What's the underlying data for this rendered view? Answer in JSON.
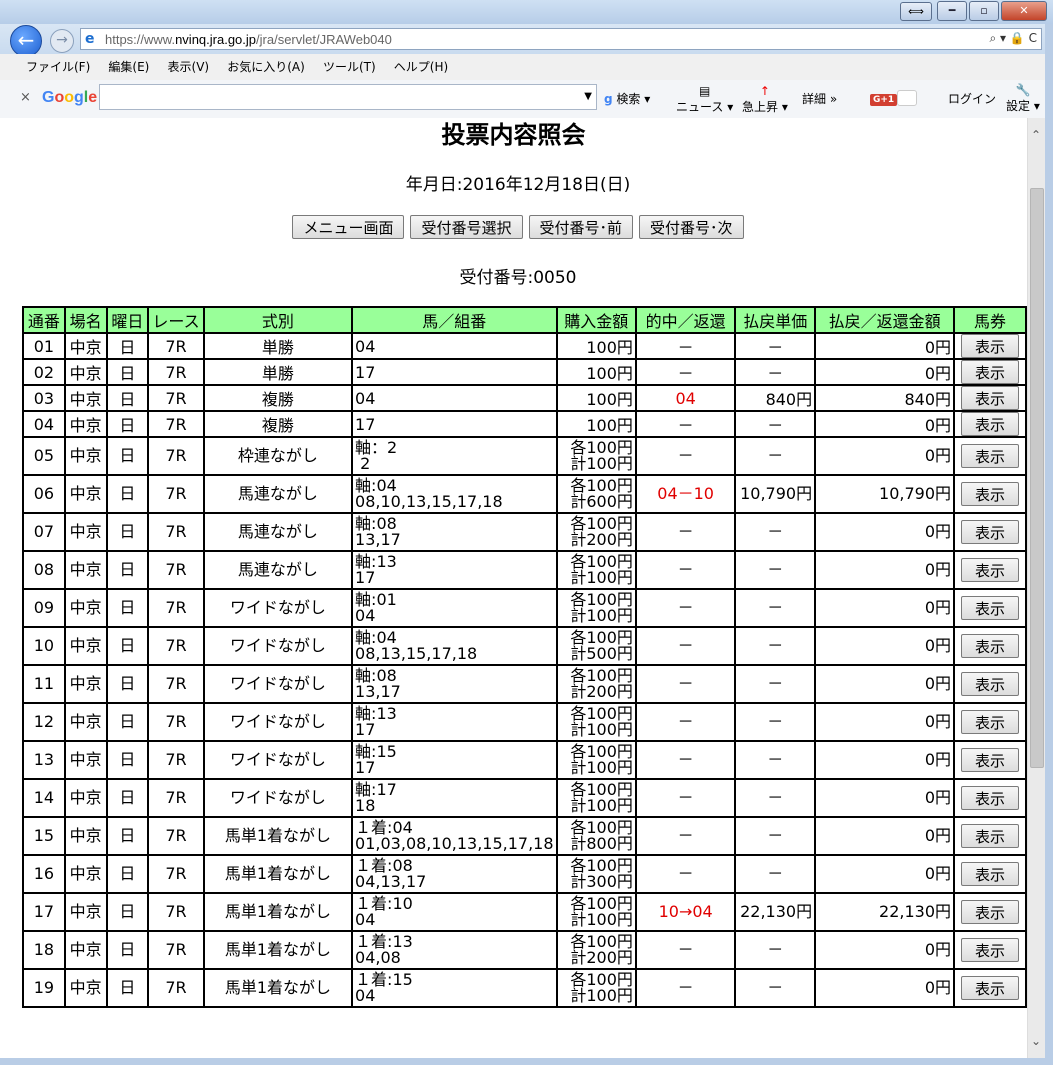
{
  "browser": {
    "url_prefix": "https://www.",
    "url_domain": "nvinq.jra.go.jp",
    "url_path": "/jra/servlet/JRAWeb040",
    "url_tools": "⌕ ▾ 🔒 C",
    "menu": [
      "ファイル(F)",
      "編集(E)",
      "表示(V)",
      "お気に入り(A)",
      "ツール(T)",
      "ヘルプ(H)"
    ],
    "google_bar": {
      "close": "×",
      "logo": "Google",
      "search_label": "検索",
      "news_label": "ニュース",
      "trending_label": "急上昇",
      "details_label": "詳細 »",
      "gplus_label": "G+1",
      "login_label": "ログイン",
      "settings_label": "設定"
    },
    "window_buttons": {
      "minimize": "━",
      "maximize": "▫",
      "close": "✕",
      "expand": "⟺"
    }
  },
  "page": {
    "title": "投票内容照会",
    "date_label": "年月日:2016年12月18日(日)",
    "buttons": {
      "menu": "メニュー画面",
      "select": "受付番号選択",
      "prev": "受付番号･前",
      "next": "受付番号･次"
    },
    "receipt_label": "受付番号:0050"
  },
  "table": {
    "headers": [
      "通番",
      "場名",
      "曜日",
      "レース",
      "式別",
      "馬／組番",
      "購入金額",
      "的中／返還",
      "払戻単価",
      "払戻／返還金額",
      "馬券"
    ],
    "show_label": "表示",
    "rows": [
      {
        "no": "01",
        "venue": "中京",
        "day": "日",
        "race": "7R",
        "type": "単勝",
        "horse1": "04",
        "horse2": "",
        "amt1": "100円",
        "amt2": "",
        "hit": "－",
        "hit_red": false,
        "unit": "－",
        "payout": "0円"
      },
      {
        "no": "02",
        "venue": "中京",
        "day": "日",
        "race": "7R",
        "type": "単勝",
        "horse1": "17",
        "horse2": "",
        "amt1": "100円",
        "amt2": "",
        "hit": "－",
        "hit_red": false,
        "unit": "－",
        "payout": "0円"
      },
      {
        "no": "03",
        "venue": "中京",
        "day": "日",
        "race": "7R",
        "type": "複勝",
        "horse1": "04",
        "horse2": "",
        "amt1": "100円",
        "amt2": "",
        "hit": "04",
        "hit_red": true,
        "unit": "840円",
        "payout": "840円"
      },
      {
        "no": "04",
        "venue": "中京",
        "day": "日",
        "race": "7R",
        "type": "複勝",
        "horse1": "17",
        "horse2": "",
        "amt1": "100円",
        "amt2": "",
        "hit": "－",
        "hit_red": false,
        "unit": "－",
        "payout": "0円"
      },
      {
        "no": "05",
        "venue": "中京",
        "day": "日",
        "race": "7R",
        "type": "枠連ながし",
        "horse1": "軸：2",
        "horse2": " 2",
        "amt1": "各100円",
        "amt2": "計100円",
        "hit": "－",
        "hit_red": false,
        "unit": "－",
        "payout": "0円"
      },
      {
        "no": "06",
        "venue": "中京",
        "day": "日",
        "race": "7R",
        "type": "馬連ながし",
        "horse1": "軸:04",
        "horse2": "08,10,13,15,17,18",
        "amt1": "各100円",
        "amt2": "計600円",
        "hit": "04－10",
        "hit_red": true,
        "unit": "10,790円",
        "payout": "10,790円"
      },
      {
        "no": "07",
        "venue": "中京",
        "day": "日",
        "race": "7R",
        "type": "馬連ながし",
        "horse1": "軸:08",
        "horse2": "13,17",
        "amt1": "各100円",
        "amt2": "計200円",
        "hit": "－",
        "hit_red": false,
        "unit": "－",
        "payout": "0円"
      },
      {
        "no": "08",
        "venue": "中京",
        "day": "日",
        "race": "7R",
        "type": "馬連ながし",
        "horse1": "軸:13",
        "horse2": "17",
        "amt1": "各100円",
        "amt2": "計100円",
        "hit": "－",
        "hit_red": false,
        "unit": "－",
        "payout": "0円"
      },
      {
        "no": "09",
        "venue": "中京",
        "day": "日",
        "race": "7R",
        "type": "ワイドながし",
        "horse1": "軸:01",
        "horse2": "04",
        "amt1": "各100円",
        "amt2": "計100円",
        "hit": "－",
        "hit_red": false,
        "unit": "－",
        "payout": "0円"
      },
      {
        "no": "10",
        "venue": "中京",
        "day": "日",
        "race": "7R",
        "type": "ワイドながし",
        "horse1": "軸:04",
        "horse2": "08,13,15,17,18",
        "amt1": "各100円",
        "amt2": "計500円",
        "hit": "－",
        "hit_red": false,
        "unit": "－",
        "payout": "0円"
      },
      {
        "no": "11",
        "venue": "中京",
        "day": "日",
        "race": "7R",
        "type": "ワイドながし",
        "horse1": "軸:08",
        "horse2": "13,17",
        "amt1": "各100円",
        "amt2": "計200円",
        "hit": "－",
        "hit_red": false,
        "unit": "－",
        "payout": "0円"
      },
      {
        "no": "12",
        "venue": "中京",
        "day": "日",
        "race": "7R",
        "type": "ワイドながし",
        "horse1": "軸:13",
        "horse2": "17",
        "amt1": "各100円",
        "amt2": "計100円",
        "hit": "－",
        "hit_red": false,
        "unit": "－",
        "payout": "0円"
      },
      {
        "no": "13",
        "venue": "中京",
        "day": "日",
        "race": "7R",
        "type": "ワイドながし",
        "horse1": "軸:15",
        "horse2": "17",
        "amt1": "各100円",
        "amt2": "計100円",
        "hit": "－",
        "hit_red": false,
        "unit": "－",
        "payout": "0円"
      },
      {
        "no": "14",
        "venue": "中京",
        "day": "日",
        "race": "7R",
        "type": "ワイドながし",
        "horse1": "軸:17",
        "horse2": "18",
        "amt1": "各100円",
        "amt2": "計100円",
        "hit": "－",
        "hit_red": false,
        "unit": "－",
        "payout": "0円"
      },
      {
        "no": "15",
        "venue": "中京",
        "day": "日",
        "race": "7R",
        "type": "馬単1着ながし",
        "horse1": "１着:04",
        "horse2": "01,03,08,10,13,15,17,18",
        "amt1": "各100円",
        "amt2": "計800円",
        "hit": "－",
        "hit_red": false,
        "unit": "－",
        "payout": "0円"
      },
      {
        "no": "16",
        "venue": "中京",
        "day": "日",
        "race": "7R",
        "type": "馬単1着ながし",
        "horse1": "１着:08",
        "horse2": "04,13,17",
        "amt1": "各100円",
        "amt2": "計300円",
        "hit": "－",
        "hit_red": false,
        "unit": "－",
        "payout": "0円"
      },
      {
        "no": "17",
        "venue": "中京",
        "day": "日",
        "race": "7R",
        "type": "馬単1着ながし",
        "horse1": "１着:10",
        "horse2": "04",
        "amt1": "各100円",
        "amt2": "計100円",
        "hit": "10→04",
        "hit_red": true,
        "unit": "22,130円",
        "payout": "22,130円"
      },
      {
        "no": "18",
        "venue": "中京",
        "day": "日",
        "race": "7R",
        "type": "馬単1着ながし",
        "horse1": "１着:13",
        "horse2": "04,08",
        "amt1": "各100円",
        "amt2": "計200円",
        "hit": "－",
        "hit_red": false,
        "unit": "－",
        "payout": "0円"
      },
      {
        "no": "19",
        "venue": "中京",
        "day": "日",
        "race": "7R",
        "type": "馬単1着ながし",
        "horse1": "１着:15",
        "horse2": "04",
        "amt1": "各100円",
        "amt2": "計100円",
        "hit": "－",
        "hit_red": false,
        "unit": "－",
        "payout": "0円"
      }
    ]
  },
  "colors": {
    "header_bg": "#99ff99",
    "hit_text": "#e00000"
  }
}
